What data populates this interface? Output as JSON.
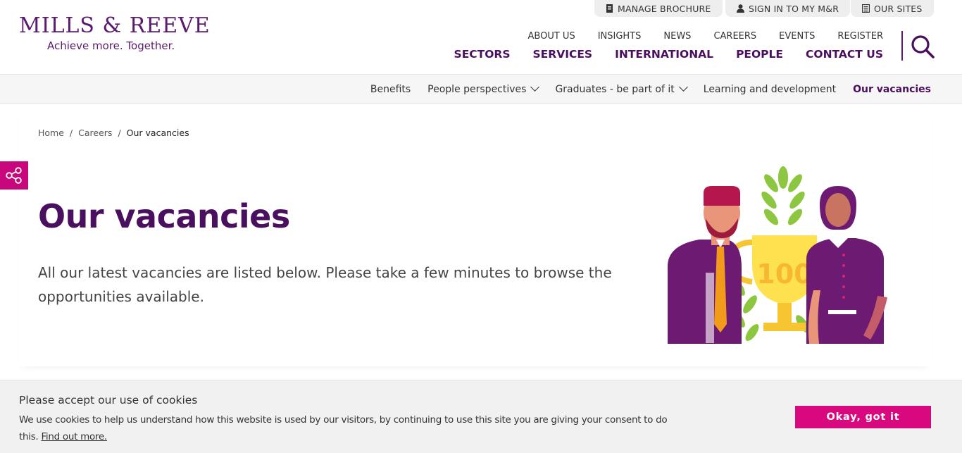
{
  "brand": {
    "name": "MILLS & REEVE",
    "tagline": "Achieve more. Together.",
    "primary_color": "#4a0f5e",
    "accent_color": "#d8087f"
  },
  "utility_nav": [
    {
      "label": "MANAGE BROCHURE",
      "icon": "brochure-icon"
    },
    {
      "label": "SIGN IN TO MY M&R",
      "icon": "user-icon"
    },
    {
      "label": "OUR SITES",
      "icon": "sites-icon"
    }
  ],
  "top_nav": [
    "ABOUT US",
    "INSIGHTS",
    "NEWS",
    "CAREERS",
    "EVENTS",
    "REGISTER"
  ],
  "main_nav": [
    "SECTORS",
    "SERVICES",
    "INTERNATIONAL",
    "PEOPLE",
    "CONTACT US"
  ],
  "search": {
    "icon": "search-icon"
  },
  "sub_nav": [
    {
      "label": "Benefits",
      "has_dropdown": false,
      "active": false
    },
    {
      "label": "People perspectives",
      "has_dropdown": true,
      "active": false
    },
    {
      "label": "Graduates - be part of it",
      "has_dropdown": true,
      "active": false
    },
    {
      "label": "Learning and development",
      "has_dropdown": false,
      "active": false
    },
    {
      "label": "Our vacancies",
      "has_dropdown": false,
      "active": true
    }
  ],
  "breadcrumb": [
    "Home",
    "Careers",
    "Our vacancies"
  ],
  "breadcrumb_separator": "/",
  "share": {
    "icon": "share-icon"
  },
  "hero": {
    "title": "Our vacancies",
    "text": "All our latest vacancies are listed below. Please take a few minutes to browse the opportunities available.",
    "illustration_text": "100"
  },
  "cookie": {
    "title": "Please accept our use of cookies",
    "text": "We use cookies to help us understand how this website is used by our visitors, by continuing to use this site you are giving your consent to do this.",
    "link": "Find out more.",
    "button": "Okay, got it"
  }
}
